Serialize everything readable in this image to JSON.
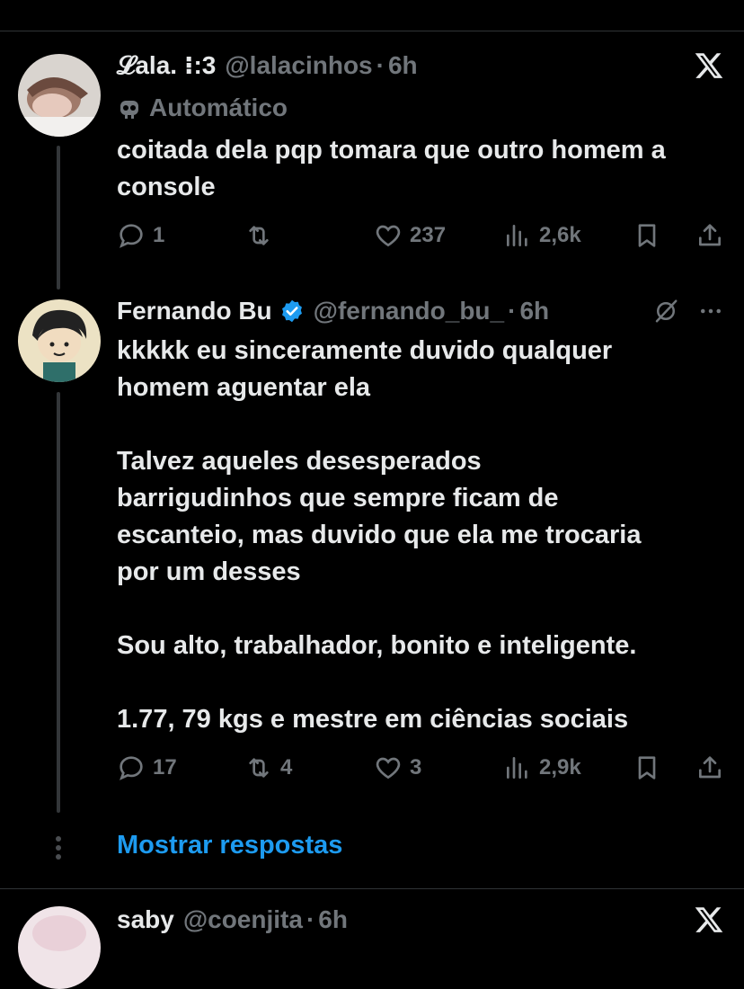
{
  "tweets": [
    {
      "display_name": "𝓛ala. ⁝:3",
      "handle": "@lalacinhos",
      "separator": "·",
      "time": "6h",
      "automated_label": "Automático",
      "text": [
        "coitada dela pqp tomara que outro homem a",
        "console"
      ],
      "replies": "1",
      "retweets": "",
      "likes": "237",
      "views": "2,6k"
    },
    {
      "display_name": "Fernando Bu",
      "handle": "@fernando_bu_",
      "separator": "·",
      "time": "6h",
      "text": [
        "kkkkk eu sinceramente duvido qualquer",
        "homem aguentar ela",
        "",
        "Talvez aqueles desesperados",
        "barrigudinhos que  sempre ficam de",
        "escanteio, mas duvido que ela me trocaria",
        "por um desses",
        "",
        "Sou alto, trabalhador,  bonito e inteligente.",
        "",
        "1.77, 79 kgs e mestre em ciências sociais"
      ],
      "replies": "17",
      "retweets": "4",
      "likes": "3",
      "views": "2,9k"
    },
    {
      "display_name": "saby",
      "handle": "@coenjita",
      "separator": "·",
      "time": "6h"
    }
  ],
  "show_replies_label": "Mostrar respostas",
  "colors": {
    "background": "#000000",
    "text": "#e7e9ea",
    "muted": "#71767b",
    "accent": "#1d9bf0",
    "verified": "#1d9bf0"
  }
}
